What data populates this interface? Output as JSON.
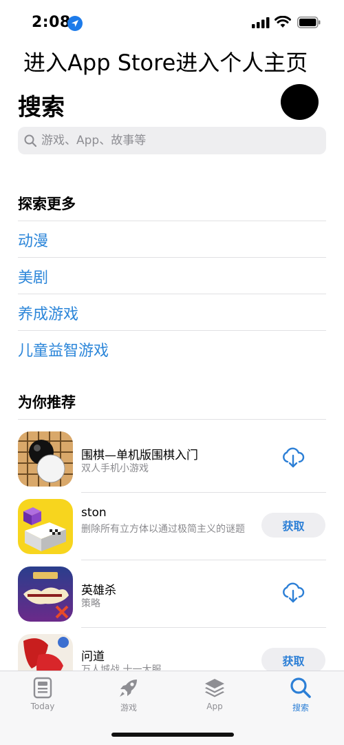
{
  "status": {
    "time": "2:08"
  },
  "overlay_title": "进入App Store进入个人主页",
  "header": {
    "title": "搜索"
  },
  "search": {
    "placeholder": "游戏、App、故事等"
  },
  "explore": {
    "title": "探索更多",
    "items": [
      "动漫",
      "美剧",
      "养成游戏",
      "儿童益智游戏"
    ]
  },
  "recommend": {
    "title": "为你推荐",
    "items": [
      {
        "name": "围棋—单机版围棋入门",
        "subtitle": "双人手机小游戏",
        "action": "download",
        "icon": "go-board-icon"
      },
      {
        "name": "ston",
        "subtitle": "删除所有立方体以通过极简主义的谜题",
        "action": "获取",
        "icon": "ston-cube-icon"
      },
      {
        "name": "英雄杀",
        "subtitle": "策略",
        "action": "download",
        "icon": "hero-kill-icon"
      },
      {
        "name": "问道",
        "subtitle": "万人城战 十一大服",
        "action": "获取",
        "icon": "wendao-icon"
      }
    ]
  },
  "tabs": [
    {
      "label": "Today",
      "icon": "today-icon",
      "active": false
    },
    {
      "label": "游戏",
      "icon": "rocket-icon",
      "active": false
    },
    {
      "label": "App",
      "icon": "layers-icon",
      "active": false
    },
    {
      "label": "搜索",
      "icon": "search-icon",
      "active": true
    }
  ],
  "colors": {
    "accent": "#2c86d9",
    "tab_active": "#2c7fd6"
  }
}
